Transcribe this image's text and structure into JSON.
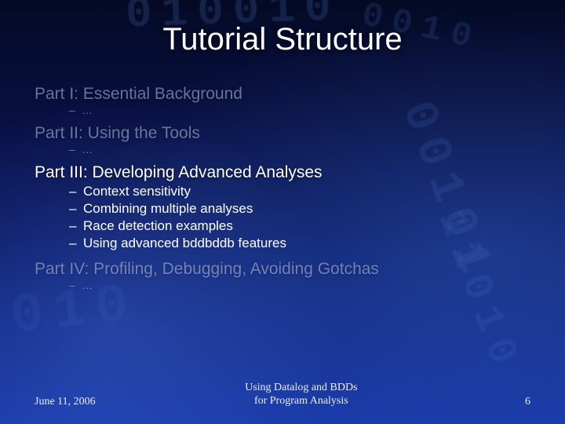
{
  "title": "Tutorial Structure",
  "parts": [
    {
      "heading": "Part I: Essential Background",
      "dim": true,
      "items": [
        "…"
      ],
      "items_dim": true,
      "tight": true
    },
    {
      "heading": "Part II: Using the Tools",
      "dim": true,
      "items": [
        "…"
      ],
      "items_dim": true,
      "tight": true
    },
    {
      "heading": "Part III: Developing Advanced Analyses",
      "dim": false,
      "items": [
        "Context sensitivity",
        "Combining multiple analyses",
        "Race detection examples",
        "Using advanced bddbddb features"
      ],
      "items_dim": false,
      "tight": false
    },
    {
      "heading": "Part IV: Profiling, Debugging, Avoiding Gotchas",
      "dim": true,
      "items": [
        "…"
      ],
      "items_dim": true,
      "tight": true
    }
  ],
  "footer": {
    "date": "June 11, 2006",
    "mid_line1": "Using Datalog and BDDs",
    "mid_line2": "for Program Analysis",
    "page": "6"
  }
}
